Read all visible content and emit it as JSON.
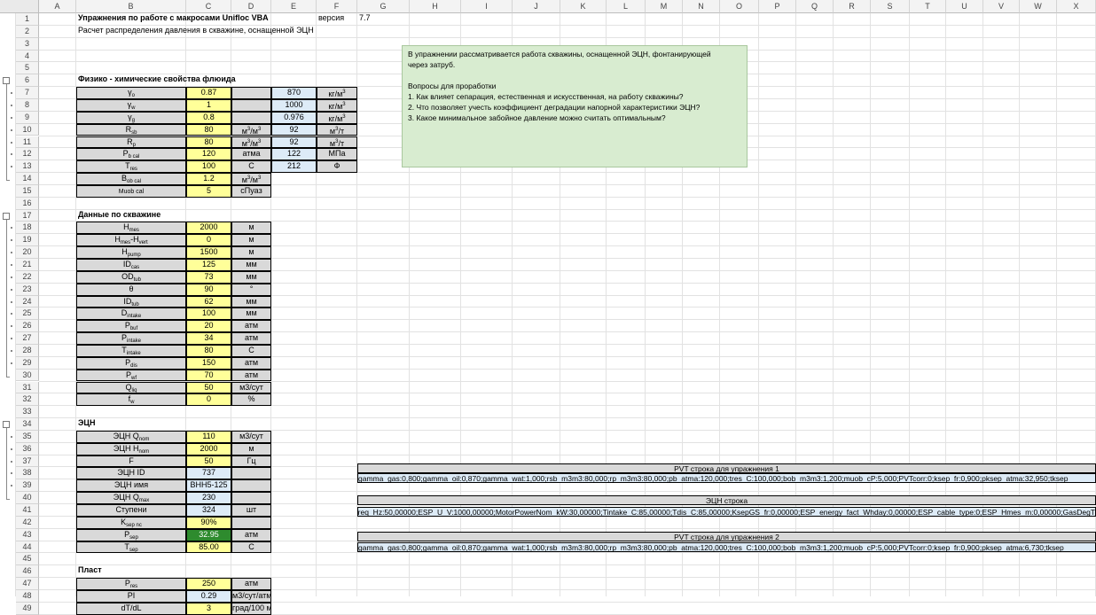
{
  "columns": [
    "A",
    "B",
    "C",
    "D",
    "E",
    "F",
    "G",
    "H",
    "I",
    "J",
    "K",
    "L",
    "M",
    "N",
    "O",
    "P",
    "Q",
    "R",
    "S",
    "T",
    "U",
    "V",
    "W",
    "X"
  ],
  "header": {
    "title": "Упражнения по работе с макросами Unifloc VBA",
    "subtitle": "Расчет распределения давления в скважине, оснащенной ЭЦН",
    "version_label": "версия",
    "version_value": "7.7"
  },
  "note": {
    "lines": [
      "В упражнении рассматривается работа скважины, оснащенной ЭЦН, фонтанирующей",
      "через затруб.",
      "",
      "Вопросы для проработки",
      "1. Как влияет сепарация, естественная и искусственная, на работу скважины?",
      "2. Что позволяет учесть коэффициент деградации напорной характеристики ЭЦН?",
      "3. Какое минимальное забойное давление можно считать оптимальным?"
    ]
  },
  "sections": {
    "fluid": "Физико - химические свойства флюида",
    "well": "Данные по скважине",
    "esp": "ЭЦН",
    "reservoir": "Пласт"
  },
  "fluid_rows": [
    {
      "row": "7",
      "label": "γo",
      "sub": "",
      "value": "0.87",
      "unit": "",
      "conv": "870",
      "conv_unit": "кг/м³"
    },
    {
      "row": "8",
      "label": "γw",
      "sub": "",
      "value": "1",
      "unit": "",
      "conv": "1000",
      "conv_unit": "кг/м³"
    },
    {
      "row": "9",
      "label": "γg",
      "sub": "",
      "value": "0.8",
      "unit": "",
      "conv": "0.976",
      "conv_unit": "кг/м³"
    },
    {
      "row": "10",
      "label": "Rsb",
      "sub": "",
      "value": "80",
      "unit": "м³/м³",
      "conv": "92",
      "conv_unit": "м³/т"
    },
    {
      "row": "11",
      "label": "Rp",
      "sub": "",
      "value": "80",
      "unit": "м³/м³",
      "conv": "92",
      "conv_unit": "м³/т"
    },
    {
      "row": "12",
      "label": "Pb cal",
      "sub": "",
      "value": "120",
      "unit": "атма",
      "conv": "122",
      "conv_unit": "МПа"
    },
    {
      "row": "13",
      "label": "Tres",
      "sub": "",
      "value": "100",
      "unit": "С",
      "conv": "212",
      "conv_unit": "Ф"
    },
    {
      "row": "14",
      "label": "Bob cal",
      "sub": "",
      "value": "1.2",
      "unit": "м³/м³",
      "conv": "",
      "conv_unit": ""
    },
    {
      "row": "15",
      "label": "Muob cal",
      "sub": "",
      "value": "5",
      "unit": "сПуаз",
      "conv": "",
      "conv_unit": ""
    }
  ],
  "well_rows": [
    {
      "row": "18",
      "label": "Hmes",
      "value": "2000",
      "unit": "м"
    },
    {
      "row": "19",
      "label": "Hmes-Hvert",
      "value": "0",
      "unit": "м"
    },
    {
      "row": "20",
      "label": "Hpump",
      "value": "1500",
      "unit": "м"
    },
    {
      "row": "21",
      "label": "IDcas",
      "value": "125",
      "unit": "мм"
    },
    {
      "row": "22",
      "label": "ODtub",
      "value": "73",
      "unit": "мм"
    },
    {
      "row": "23",
      "label": "θ",
      "value": "90",
      "unit": "°"
    },
    {
      "row": "24",
      "label": "IDtub",
      "value": "62",
      "unit": "мм"
    },
    {
      "row": "25",
      "label": "Dintake",
      "value": "100",
      "unit": "мм"
    },
    {
      "row": "26",
      "label": "Pbuf",
      "value": "20",
      "unit": "атм"
    },
    {
      "row": "27",
      "label": "Pintake",
      "value": "34",
      "unit": "атм"
    },
    {
      "row": "28",
      "label": "Tintake",
      "value": "80",
      "unit": "С"
    },
    {
      "row": "29",
      "label": "Pdis",
      "value": "150",
      "unit": "атм"
    },
    {
      "row": "30",
      "label": "Pwf",
      "value": "70",
      "unit": "атм"
    },
    {
      "row": "31",
      "label": "Qliq",
      "value": "50",
      "unit": "м3/сут"
    },
    {
      "row": "32",
      "label": "fw",
      "value": "0",
      "unit": "%"
    }
  ],
  "esp_rows": [
    {
      "row": "35",
      "label": "ЭЦН Qnom",
      "value": "110",
      "unit": "м3/сут",
      "style": "yel"
    },
    {
      "row": "36",
      "label": "ЭЦН Hnom",
      "value": "2000",
      "unit": "м",
      "style": "yel"
    },
    {
      "row": "37",
      "label": "F",
      "value": "50",
      "unit": "Гц",
      "style": "yel"
    },
    {
      "row": "38",
      "label": "ЭЦН ID",
      "value": "737",
      "unit": "",
      "style": "blue"
    },
    {
      "row": "39",
      "label": "ЭЦН имя",
      "value": "ВНН5-125",
      "unit": "",
      "style": "blue"
    },
    {
      "row": "40",
      "label": "ЭЦН Qmax",
      "value": "230",
      "unit": "",
      "style": "blue"
    },
    {
      "row": "41",
      "label": "Ступени",
      "value": "324",
      "unit": "шт",
      "style": "blue"
    },
    {
      "row": "42",
      "label": "Ksep nc",
      "value": "90%",
      "unit": "",
      "style": "yel"
    },
    {
      "row": "43",
      "label": "Psep",
      "value": "32.95",
      "unit": "атм",
      "style": "grn"
    },
    {
      "row": "44",
      "label": "Tsep",
      "value": "85.00",
      "unit": "С",
      "style": "yel"
    }
  ],
  "reservoir_rows": [
    {
      "row": "47",
      "label": "Pres",
      "value": "250",
      "unit": "атм",
      "style": "yel"
    },
    {
      "row": "48",
      "label": "PI",
      "value": "0.29",
      "unit": "м3/сут/атм",
      "style": "blue"
    },
    {
      "row": "49",
      "label": "dT/dL",
      "value": "3",
      "unit": "град/100 м",
      "style": "yel"
    }
  ],
  "pvt_strings": [
    {
      "title": "PVT строка для упражнения 1",
      "value": "gamma_gas:0,800;gamma_oil:0,870;gamma_wat:1,000;rsb_m3m3:80,000;rp_m3m3:80,000;pb_atma:120,000;tres_C:100,000;bob_m3m3:1,200;muob_cP:5,000;PVTcorr:0;ksep_fr:0,900;pksep_atma:32,950;tksep"
    },
    {
      "title": "ЭЦН строка",
      "value": "ESP_ID:737,00000;HeadNom_m:2000,00000;ESPfreq_Hz:50,00000;ESP_U_V:1000,00000;MotorPowerNom_kW:30,00000;Tintake_C:85,00000;Tdis_C:85,00000;KsepGS_fr:0,00000;ESP_energy_fact_Whday:0,00000;ESP_cable_type:0;ESP_Hmes_m:0,00000;GasDegT"
    },
    {
      "title": "PVT строка для упражнения 2",
      "value": "gamma_gas:0,800;gamma_oil:0,870;gamma_wat:1,000;rsb_m3m3:80,000;rp_m3m3:80,000;pb_atma:120,000;tres_C:100,000;bob_m3m3:1,200;muob_cP:5,000;PVTcorr:0;ksep_fr:0,900;pksep_atma:6,730;tksep"
    }
  ]
}
